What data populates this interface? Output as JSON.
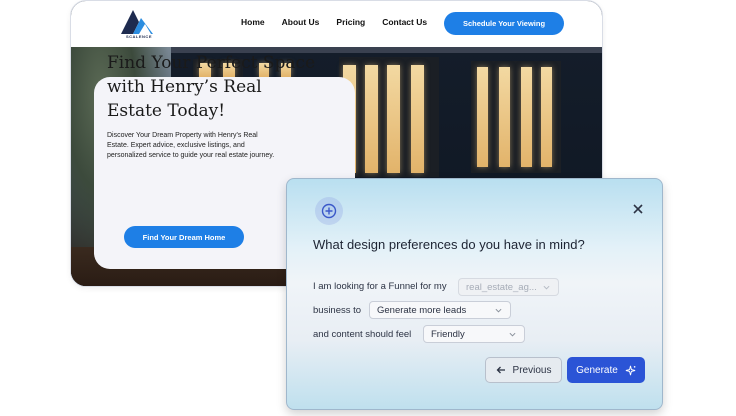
{
  "site": {
    "logo_text": "SCALENCE",
    "nav": [
      "Home",
      "About Us",
      "Pricing",
      "Contact Us"
    ],
    "cta_label": "Schedule Your Viewing",
    "hero": {
      "title": "Find Your Perfect Space with Henry’s Real Estate Today!",
      "description": "Discover Your Dream Property with Henry's Real Estate. Expert advice, exclusive listings, and personalized service to guide your real estate journey.",
      "button_label": "Find Your Dream Home"
    }
  },
  "modal": {
    "question": "What design preferences do you have in mind?",
    "row1_text": "I am looking for a Funnel for my",
    "row1_select": "real_estate_ag...",
    "row2_text": "business to",
    "row2_select": "Generate more leads",
    "row3_text": "and content should feel",
    "row3_select": "Friendly",
    "previous_label": "Previous",
    "generate_label": "Generate"
  },
  "colors": {
    "accent_blue": "#1e7fe6",
    "generate_blue": "#2b54d6"
  },
  "icons": [
    "add-circle-icon",
    "close-icon",
    "chevron-down-icon",
    "arrow-left-icon",
    "sparkle-icon"
  ]
}
